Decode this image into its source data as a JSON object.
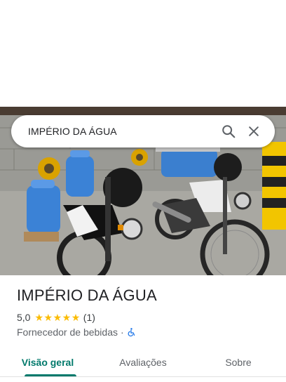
{
  "search": {
    "query": "IMPÉRIO DA ÁGUA"
  },
  "place": {
    "name": "IMPÉRIO DA ÁGUA",
    "rating": "5,0",
    "stars": 5,
    "reviews": "(1)",
    "category": "Fornecedor de bebidas",
    "separator": "·"
  },
  "tabs": [
    {
      "label": "Visão geral",
      "active": true
    },
    {
      "label": "Avaliações",
      "active": false
    },
    {
      "label": "Sobre",
      "active": false
    }
  ],
  "icons": {
    "search": "search-icon",
    "close": "close-icon",
    "accessibility": "wheelchair-icon"
  },
  "colors": {
    "accent": "#00796b",
    "star": "#fbbc04",
    "accessibility": "#1a73e8"
  }
}
